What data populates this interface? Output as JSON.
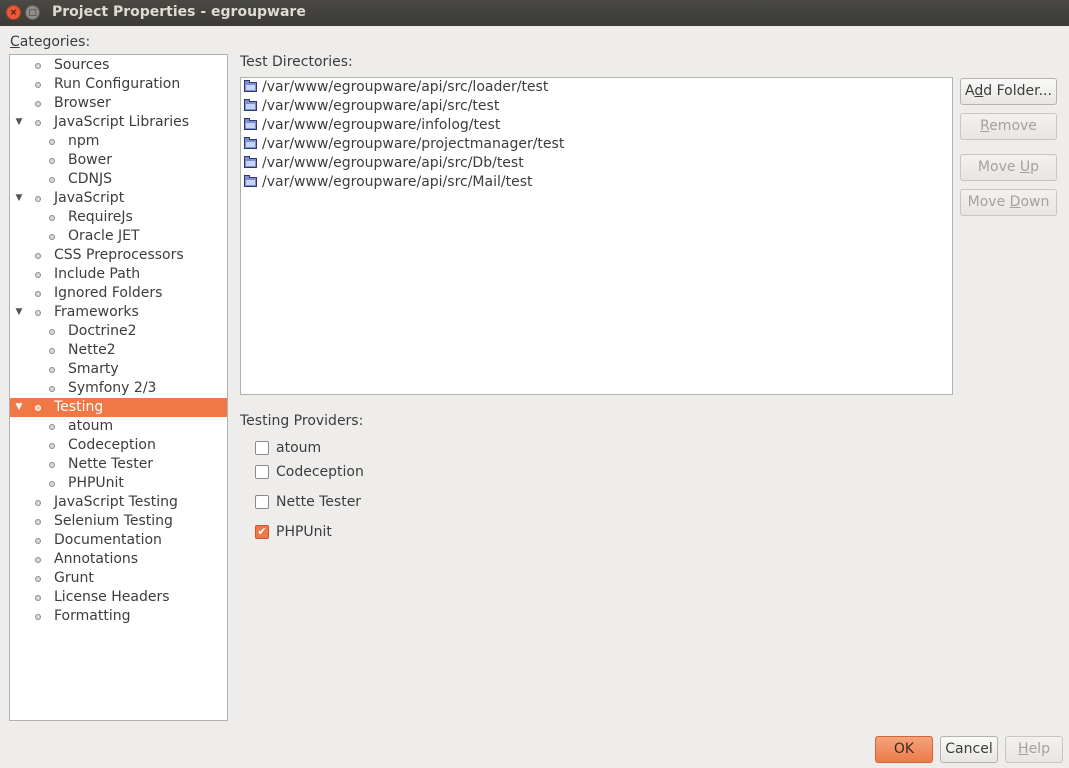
{
  "window": {
    "title": "Project Properties - egroupware",
    "close_symbol": "×",
    "max_symbol": "□"
  },
  "categories": {
    "label_prefix": "C",
    "label_rest": "ategories:",
    "items": [
      {
        "label": "Sources",
        "level": 0,
        "expanded": false
      },
      {
        "label": "Run Configuration",
        "level": 0,
        "expanded": false
      },
      {
        "label": "Browser",
        "level": 0,
        "expanded": false
      },
      {
        "label": "JavaScript Libraries",
        "level": 0,
        "expanded": true
      },
      {
        "label": "npm",
        "level": 1,
        "expanded": false
      },
      {
        "label": "Bower",
        "level": 1,
        "expanded": false
      },
      {
        "label": "CDNJS",
        "level": 1,
        "expanded": false
      },
      {
        "label": "JavaScript",
        "level": 0,
        "expanded": true
      },
      {
        "label": "RequireJs",
        "level": 1,
        "expanded": false
      },
      {
        "label": "Oracle JET",
        "level": 1,
        "expanded": false
      },
      {
        "label": "CSS Preprocessors",
        "level": 0,
        "expanded": false
      },
      {
        "label": "Include Path",
        "level": 0,
        "expanded": false
      },
      {
        "label": "Ignored Folders",
        "level": 0,
        "expanded": false
      },
      {
        "label": "Frameworks",
        "level": 0,
        "expanded": true
      },
      {
        "label": "Doctrine2",
        "level": 1,
        "expanded": false
      },
      {
        "label": "Nette2",
        "level": 1,
        "expanded": false
      },
      {
        "label": "Smarty",
        "level": 1,
        "expanded": false
      },
      {
        "label": "Symfony 2/3",
        "level": 1,
        "expanded": false
      },
      {
        "label": "Testing",
        "level": 0,
        "expanded": true,
        "selected": true
      },
      {
        "label": "atoum",
        "level": 1,
        "expanded": false
      },
      {
        "label": "Codeception",
        "level": 1,
        "expanded": false
      },
      {
        "label": "Nette Tester",
        "level": 1,
        "expanded": false
      },
      {
        "label": "PHPUnit",
        "level": 1,
        "expanded": false
      },
      {
        "label": "JavaScript Testing",
        "level": 0,
        "expanded": false
      },
      {
        "label": "Selenium Testing",
        "level": 0,
        "expanded": false
      },
      {
        "label": "Documentation",
        "level": 0,
        "expanded": false
      },
      {
        "label": "Annotations",
        "level": 0,
        "expanded": false
      },
      {
        "label": "Grunt",
        "level": 0,
        "expanded": false
      },
      {
        "label": "License Headers",
        "level": 0,
        "expanded": false
      },
      {
        "label": "Formatting",
        "level": 0,
        "expanded": false
      }
    ]
  },
  "test_directories": {
    "label": "Test Directories:",
    "items": [
      "/var/www/egroupware/api/src/loader/test",
      "/var/www/egroupware/api/src/test",
      "/var/www/egroupware/infolog/test",
      "/var/www/egroupware/projectmanager/test",
      "/var/www/egroupware/api/src/Db/test",
      "/var/www/egroupware/api/src/Mail/test"
    ],
    "icon": "folder-icon"
  },
  "side_buttons": {
    "add_folder": {
      "pre": "A",
      "mn": "d",
      "post": "d Folder..."
    },
    "remove": {
      "pre": "",
      "mn": "R",
      "post": "emove"
    },
    "move_up": {
      "pre": "Move ",
      "mn": "U",
      "post": "p"
    },
    "move_down": {
      "pre": "Move ",
      "mn": "D",
      "post": "own"
    }
  },
  "testing_providers": {
    "label": "Testing Providers:",
    "items": [
      {
        "label": "atoum",
        "checked": false
      },
      {
        "label": "Codeception",
        "checked": false
      },
      {
        "label": "Nette Tester",
        "checked": false
      },
      {
        "label": "PHPUnit",
        "checked": true
      }
    ]
  },
  "footer": {
    "ok": "OK",
    "cancel": "Cancel",
    "help_mn": "H",
    "help_rest": "elp"
  },
  "colors": {
    "accent": "#f07746",
    "background": "#eeedeb",
    "titlebar": "#3c3b37"
  }
}
